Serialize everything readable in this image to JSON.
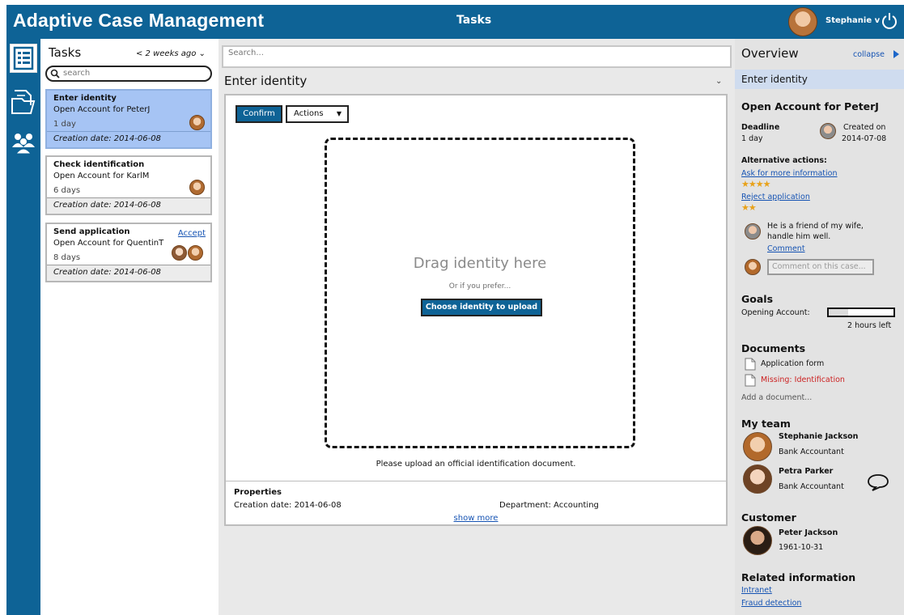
{
  "header": {
    "app_title": "Adaptive Case Management",
    "page_title": "Tasks",
    "user_name": "Stephanie v"
  },
  "tasks": {
    "heading": "Tasks",
    "filter": "< 2 weeks ago",
    "search_placeholder": "search",
    "items": [
      {
        "name": "Enter identity",
        "subtitle": "Open Account for PeterJ",
        "age": "1 day",
        "creation": "Creation date: 2014-06-08",
        "selected": true
      },
      {
        "name": "Check identification",
        "subtitle": "Open Account for KarlM",
        "age": "6 days",
        "creation": "Creation date: 2014-06-08",
        "selected": false
      },
      {
        "name": "Send application",
        "subtitle": "Open Account for QuentinT",
        "age": "8 days",
        "creation": "Creation date: 2014-06-08",
        "accept": "Accept",
        "selected": false
      }
    ]
  },
  "main": {
    "search_placeholder": "Search...",
    "title": "Enter identity",
    "confirm": "Confirm",
    "actions": "Actions",
    "drop_title": "Drag identity here",
    "drop_sub": "Or if you prefer...",
    "upload_button": "Choose identity to upload",
    "hint": "Please upload an official identification document.",
    "properties": {
      "title": "Properties",
      "creation": "Creation date: 2014-06-08",
      "department": "Department: Accounting",
      "show_more": "show more"
    }
  },
  "overview": {
    "title": "Overview",
    "collapse": "collapse",
    "current_task": "Enter identity",
    "case_title": "Open Account for PeterJ",
    "deadline_label": "Deadline",
    "deadline_value": "1 day",
    "created_label": "Created on",
    "created_value": "2014-07-08",
    "alt_actions_label": "Alternative actions:",
    "alt_actions": [
      {
        "label": "Ask for more information",
        "stars": 4
      },
      {
        "label": "Reject application",
        "stars": 2
      }
    ],
    "comment_text_line1": "He is a friend of my wife,",
    "comment_text_line2": "handle him well.",
    "comment_link": "Comment",
    "comment_placeholder": "Comment on this case...",
    "goals_title": "Goals",
    "goal_label": "Opening Account:",
    "goal_progress": 0.3,
    "goal_time": "2 hours left",
    "documents_title": "Documents",
    "documents": [
      {
        "label": "Application form",
        "missing": false
      },
      {
        "label": "Missing: Identification",
        "missing": true
      }
    ],
    "add_document": "Add a document...",
    "team_title": "My team",
    "team": [
      {
        "name": "Stephanie Jackson",
        "role": "Bank Accountant"
      },
      {
        "name": "Petra Parker",
        "role": "Bank Accountant"
      }
    ],
    "customer_title": "Customer",
    "customer_name": "Peter Jackson",
    "customer_dob": "1961-10-31",
    "related_title": "Related information",
    "related_links": [
      "Intranet",
      "Fraud detection"
    ]
  },
  "colors": {
    "brand": "#0e6396",
    "selected_task": "#a6c4f4",
    "link": "#1553b3",
    "missing": "#cc2222",
    "stars": "#e8a21a"
  }
}
